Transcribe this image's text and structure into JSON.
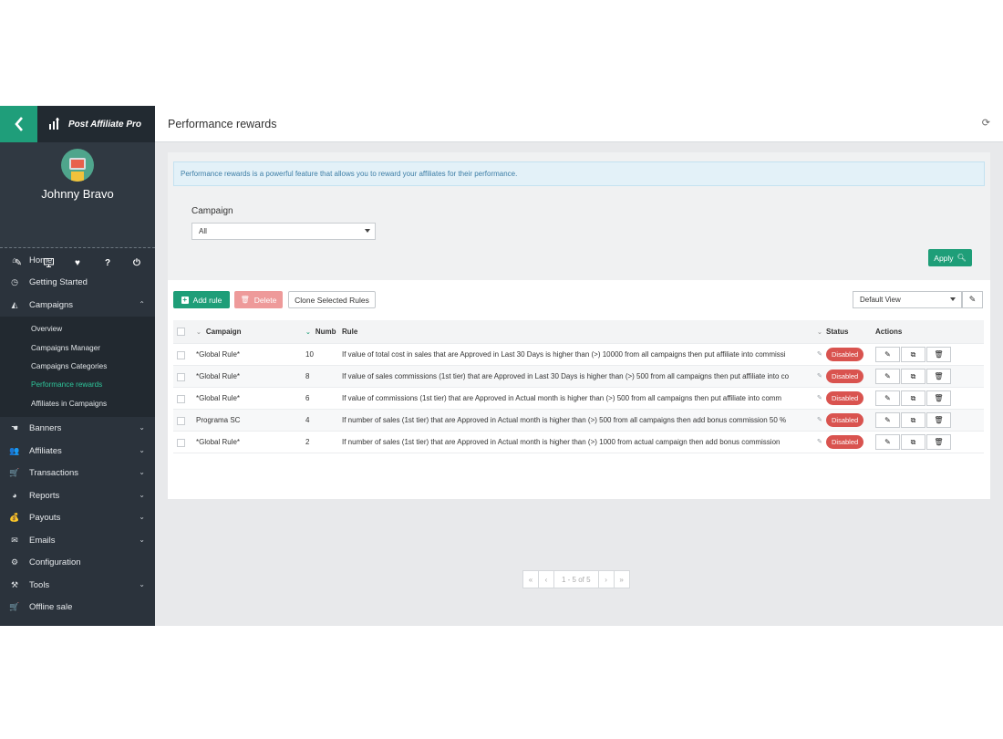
{
  "sidebar": {
    "logo_text": "Post Affiliate Pro",
    "user_name": "Johnny Bravo",
    "nav": {
      "home": "Home",
      "getting_started": "Getting Started",
      "campaigns": "Campaigns",
      "banners": "Banners",
      "affiliates": "Affiliates",
      "transactions": "Transactions",
      "reports": "Reports",
      "payouts": "Payouts",
      "emails": "Emails",
      "configuration": "Configuration",
      "tools": "Tools",
      "offline_sale": "Offline sale"
    },
    "campaign_sub": [
      "Overview",
      "Campaigns Manager",
      "Campaigns Categories",
      "Performance rewards",
      "Affiliates in Campaigns"
    ],
    "active_sub": "Performance rewards"
  },
  "header": {
    "title": "Performance rewards"
  },
  "info": "Performance rewards is a powerful feature that allows you to reward your affiliates for their performance.",
  "filter": {
    "campaign_label": "Campaign",
    "campaign_value": "All",
    "apply_label": "Apply"
  },
  "toolbar": {
    "add_rule": "Add rule",
    "delete": "Delete",
    "clone": "Clone Selected Rules",
    "view": "Default View"
  },
  "table": {
    "headers": {
      "campaign": "Campaign",
      "number": "Numb",
      "rule": "Rule",
      "status": "Status",
      "actions": "Actions"
    },
    "rows": [
      {
        "campaign": "*Global Rule*",
        "number": "10",
        "rule": "If value of total cost in sales that are Approved in Last 30 Days is higher than (>) 10000 from all campaigns then put affiliate into commissi",
        "status": "Disabled"
      },
      {
        "campaign": "*Global Rule*",
        "number": "8",
        "rule": "If value of sales commissions (1st tier) that are Approved in Last 30 Days is higher than (>) 500 from all campaigns then put affiliate into co",
        "status": "Disabled"
      },
      {
        "campaign": "*Global Rule*",
        "number": "6",
        "rule": "If value of commissions (1st tier) that are Approved in Actual month is higher than (>) 500 from all campaigns then put affiliate into comm",
        "status": "Disabled"
      },
      {
        "campaign": "Programa SC",
        "number": "4",
        "rule": "If number of sales (1st tier) that are Approved in Actual month is higher than (>) 500 from all campaigns then add bonus commission 50 %",
        "status": "Disabled"
      },
      {
        "campaign": "*Global Rule*",
        "number": "2",
        "rule": "If number of sales (1st tier) that are Approved in Actual month is higher than (>) 1000 from actual campaign then add bonus commission",
        "status": "Disabled"
      }
    ]
  },
  "pager": {
    "first": "«",
    "prev": "‹",
    "info": "1 - 5 of 5",
    "next": "›",
    "last": "»"
  },
  "colors": {
    "accent": "#1e9e78",
    "sidebar": "#2b333c",
    "danger": "#d9534f",
    "active_link": "#2ec59a"
  }
}
